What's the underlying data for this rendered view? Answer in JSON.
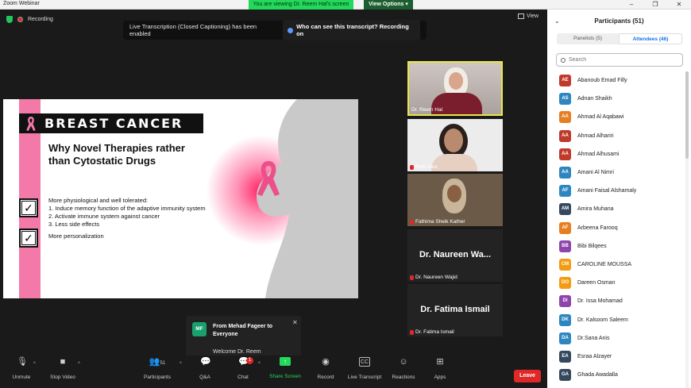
{
  "window": {
    "app_title": "Zoom Webinar",
    "viewing_banner": "You are viewing Dr. Reem Hal's screen",
    "view_options": "View Options"
  },
  "meeting": {
    "recording_label": "Recording",
    "view_label": "View",
    "transcript_message": "Live Transcription (Closed Captioning) has been enabled",
    "transcript_link": "Who can see this transcript? Recording on"
  },
  "slide": {
    "title": "BREAST CANCER",
    "heading": "Why Novel Therapies rather than Cytostatic Drugs",
    "intro": "More physiological and well tolerated:",
    "points": [
      "1.  Induce memory function of the adaptive immunity system",
      "2.  Activate immune system against cancer",
      "3.  Less side effects"
    ],
    "extra": "More personalization",
    "accent_color": "#f279a8"
  },
  "videos": [
    {
      "name": "Dr. Reem Hal",
      "type": "video",
      "active": true
    },
    {
      "name": "Ruth Alex",
      "type": "video"
    },
    {
      "name": "Fathima Sheik Kather",
      "type": "video"
    },
    {
      "name": "Dr. Naureen Wajid",
      "type": "name",
      "display": "Dr. Naureen Wa..."
    },
    {
      "name": "Dr. Fatima Ismail",
      "type": "name",
      "display": "Dr. Fatima Ismail"
    }
  ],
  "chat": {
    "avatar": "MF",
    "from": "From Mehad Fageer to Everyone",
    "message": "Welcome Dr. Reem"
  },
  "toolbar": {
    "unmute": "Unmute",
    "stop_video": "Stop Video",
    "participants": "Participants",
    "participants_count": "51",
    "qa": "Q&A",
    "chat": "Chat",
    "chat_badge": "1",
    "share_screen": "Share Screen",
    "record": "Record",
    "live_transcript": "Live Transcript",
    "reactions": "Reactions",
    "apps": "Apps",
    "leave": "Leave"
  },
  "panel": {
    "title": "Participants (51)",
    "tabs": [
      "Panelists (5)",
      "Attendees (46)"
    ],
    "active_tab": 1,
    "search_placeholder": "Search",
    "attendees": [
      {
        "initials": "AE",
        "name": "Abanoub Emad Filly",
        "color": "#c0392b"
      },
      {
        "initials": "AS",
        "name": "Adnan Shaikh",
        "color": "#2e86c1"
      },
      {
        "initials": "AA",
        "name": "Ahmad Al Aqabawi",
        "color": "#e67e22"
      },
      {
        "initials": "AA",
        "name": "Ahmad Alhariri",
        "color": "#c0392b"
      },
      {
        "initials": "AA",
        "name": "Ahmad Alhusami",
        "color": "#c0392b"
      },
      {
        "initials": "AA",
        "name": "Amani Al Nimri",
        "color": "#2e86c1"
      },
      {
        "initials": "AF",
        "name": "Amani Faisal Alshamaly",
        "color": "#2e86c1"
      },
      {
        "initials": "AM",
        "name": "Amira Muhana",
        "color": "#34495e"
      },
      {
        "initials": "AF",
        "name": "Arbeena Farooq",
        "color": "#e67e22"
      },
      {
        "initials": "BB",
        "name": "Bibi Bilqees",
        "color": "#8e44ad"
      },
      {
        "initials": "CM",
        "name": "CAROLINE MOUSSA",
        "color": "#f39c12"
      },
      {
        "initials": "DO",
        "name": "Dareen Osman",
        "color": "#f39c12"
      },
      {
        "initials": "DI",
        "name": "Dr. Issa Mohamad",
        "color": "#8e44ad"
      },
      {
        "initials": "DK",
        "name": "Dr. Kalsoom Saleem",
        "color": "#2e86c1"
      },
      {
        "initials": "DA",
        "name": "Dr.Sana Anis",
        "color": "#2e86c1"
      },
      {
        "initials": "EA",
        "name": "Esraa Alzayer",
        "color": "#34495e"
      },
      {
        "initials": "GA",
        "name": "Ghada Awadalla",
        "color": "#34495e"
      }
    ]
  }
}
